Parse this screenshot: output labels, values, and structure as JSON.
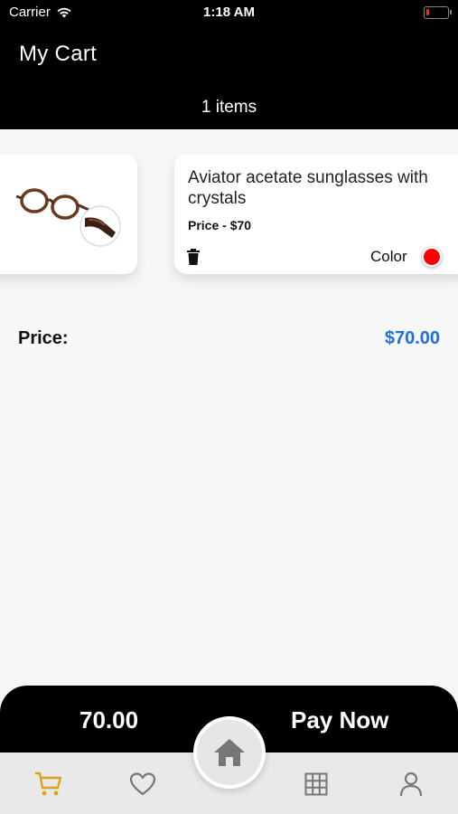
{
  "status_bar": {
    "carrier": "Carrier",
    "time": "1:18 AM",
    "battery_level_fraction": 0.15
  },
  "header": {
    "title": "My Cart",
    "items_count": "1 items"
  },
  "cart": {
    "items": [
      {
        "name": "Aviator acetate sunglasses with crystals",
        "price": "Price - $70",
        "color_label": "Color",
        "color_value": "#ff0000",
        "image_icon": "glasses-image"
      }
    ]
  },
  "summary": {
    "price_label": "Price:",
    "price_value": "$70.00"
  },
  "pay_bar": {
    "total": "70.00",
    "pay_now_label": "Pay Now"
  },
  "bottom_nav": {
    "active": "cart",
    "accent_color": "#e0a21a",
    "items": [
      "cart-icon",
      "heart-icon",
      "home-icon",
      "grid-icon",
      "user-icon"
    ]
  }
}
